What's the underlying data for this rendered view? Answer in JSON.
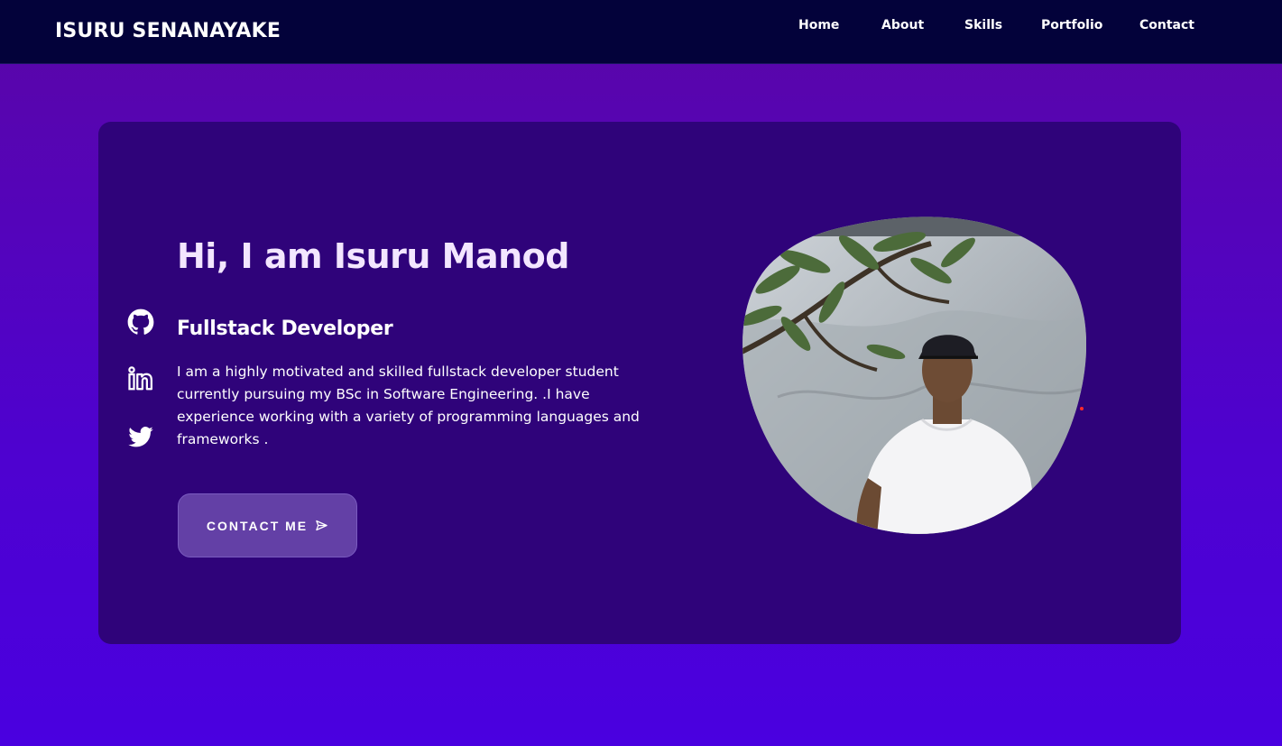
{
  "header": {
    "logo": "ISURU SENANAYAKE",
    "nav": [
      {
        "label": "Home"
      },
      {
        "label": "About"
      },
      {
        "label": "Skills"
      },
      {
        "label": "Portfolio"
      },
      {
        "label": "Contact"
      }
    ]
  },
  "social": [
    {
      "icon": "github-icon"
    },
    {
      "icon": "linkedin-icon"
    },
    {
      "icon": "twitter-icon"
    }
  ],
  "hero": {
    "title": "Hi, I am Isuru Manod",
    "subtitle": "Fullstack Developer",
    "description": "I am a highly motivated and skilled fullstack developer student currently pursuing my BSc in Software Engineering. .I have experience working with a variety of programming languages and frameworks .",
    "button_label": "CONTACT ME",
    "button_icon": "send-icon"
  },
  "profile_image": {
    "icon": "profile-photo"
  },
  "colors": {
    "navbar": "#03023a",
    "card": "#2f037a",
    "background_top": "#5a06a6",
    "background_bottom": "#4a00e0",
    "button": "#6340a6"
  }
}
